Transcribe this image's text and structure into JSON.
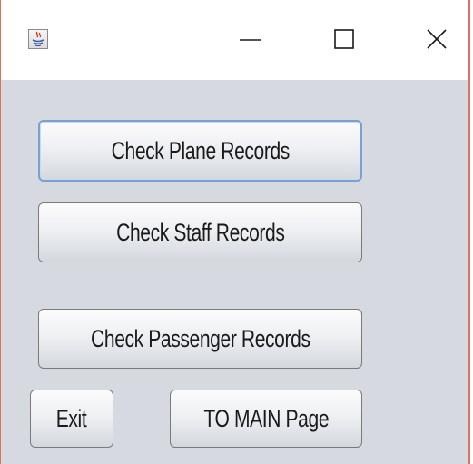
{
  "titlebar": {
    "app_icon": "java-coffee-cup-icon",
    "minimize_icon": "minimize-icon",
    "maximize_icon": "maximize-icon",
    "close_icon": "close-icon"
  },
  "buttons": {
    "plane_records": "Check Plane Records",
    "staff_records": "Check Staff Records",
    "passenger_records": "Check Passenger Records",
    "exit": "Exit",
    "main_page": "TO MAIN Page"
  },
  "colors": {
    "window_border": "#e07060",
    "content_background": "#d6d9e0",
    "focus_border": "#7aa0d0"
  }
}
